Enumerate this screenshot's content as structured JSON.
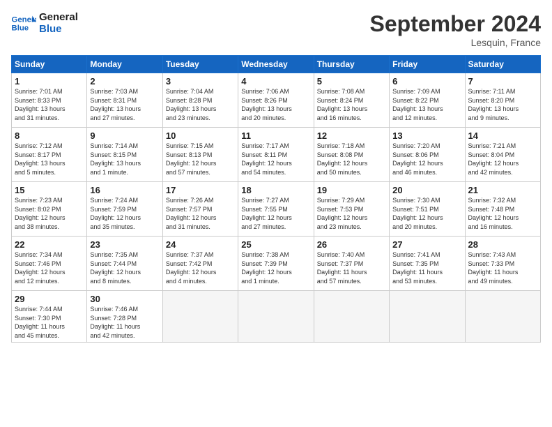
{
  "logo": {
    "line1": "General",
    "line2": "Blue"
  },
  "title": "September 2024",
  "location": "Lesquin, France",
  "days_header": [
    "Sunday",
    "Monday",
    "Tuesday",
    "Wednesday",
    "Thursday",
    "Friday",
    "Saturday"
  ],
  "weeks": [
    [
      {
        "day": "1",
        "info": "Sunrise: 7:01 AM\nSunset: 8:33 PM\nDaylight: 13 hours\nand 31 minutes."
      },
      {
        "day": "2",
        "info": "Sunrise: 7:03 AM\nSunset: 8:31 PM\nDaylight: 13 hours\nand 27 minutes."
      },
      {
        "day": "3",
        "info": "Sunrise: 7:04 AM\nSunset: 8:28 PM\nDaylight: 13 hours\nand 23 minutes."
      },
      {
        "day": "4",
        "info": "Sunrise: 7:06 AM\nSunset: 8:26 PM\nDaylight: 13 hours\nand 20 minutes."
      },
      {
        "day": "5",
        "info": "Sunrise: 7:08 AM\nSunset: 8:24 PM\nDaylight: 13 hours\nand 16 minutes."
      },
      {
        "day": "6",
        "info": "Sunrise: 7:09 AM\nSunset: 8:22 PM\nDaylight: 13 hours\nand 12 minutes."
      },
      {
        "day": "7",
        "info": "Sunrise: 7:11 AM\nSunset: 8:20 PM\nDaylight: 13 hours\nand 9 minutes."
      }
    ],
    [
      {
        "day": "8",
        "info": "Sunrise: 7:12 AM\nSunset: 8:17 PM\nDaylight: 13 hours\nand 5 minutes."
      },
      {
        "day": "9",
        "info": "Sunrise: 7:14 AM\nSunset: 8:15 PM\nDaylight: 13 hours\nand 1 minute."
      },
      {
        "day": "10",
        "info": "Sunrise: 7:15 AM\nSunset: 8:13 PM\nDaylight: 12 hours\nand 57 minutes."
      },
      {
        "day": "11",
        "info": "Sunrise: 7:17 AM\nSunset: 8:11 PM\nDaylight: 12 hours\nand 54 minutes."
      },
      {
        "day": "12",
        "info": "Sunrise: 7:18 AM\nSunset: 8:08 PM\nDaylight: 12 hours\nand 50 minutes."
      },
      {
        "day": "13",
        "info": "Sunrise: 7:20 AM\nSunset: 8:06 PM\nDaylight: 12 hours\nand 46 minutes."
      },
      {
        "day": "14",
        "info": "Sunrise: 7:21 AM\nSunset: 8:04 PM\nDaylight: 12 hours\nand 42 minutes."
      }
    ],
    [
      {
        "day": "15",
        "info": "Sunrise: 7:23 AM\nSunset: 8:02 PM\nDaylight: 12 hours\nand 38 minutes."
      },
      {
        "day": "16",
        "info": "Sunrise: 7:24 AM\nSunset: 7:59 PM\nDaylight: 12 hours\nand 35 minutes."
      },
      {
        "day": "17",
        "info": "Sunrise: 7:26 AM\nSunset: 7:57 PM\nDaylight: 12 hours\nand 31 minutes."
      },
      {
        "day": "18",
        "info": "Sunrise: 7:27 AM\nSunset: 7:55 PM\nDaylight: 12 hours\nand 27 minutes."
      },
      {
        "day": "19",
        "info": "Sunrise: 7:29 AM\nSunset: 7:53 PM\nDaylight: 12 hours\nand 23 minutes."
      },
      {
        "day": "20",
        "info": "Sunrise: 7:30 AM\nSunset: 7:51 PM\nDaylight: 12 hours\nand 20 minutes."
      },
      {
        "day": "21",
        "info": "Sunrise: 7:32 AM\nSunset: 7:48 PM\nDaylight: 12 hours\nand 16 minutes."
      }
    ],
    [
      {
        "day": "22",
        "info": "Sunrise: 7:34 AM\nSunset: 7:46 PM\nDaylight: 12 hours\nand 12 minutes."
      },
      {
        "day": "23",
        "info": "Sunrise: 7:35 AM\nSunset: 7:44 PM\nDaylight: 12 hours\nand 8 minutes."
      },
      {
        "day": "24",
        "info": "Sunrise: 7:37 AM\nSunset: 7:42 PM\nDaylight: 12 hours\nand 4 minutes."
      },
      {
        "day": "25",
        "info": "Sunrise: 7:38 AM\nSunset: 7:39 PM\nDaylight: 12 hours\nand 1 minute."
      },
      {
        "day": "26",
        "info": "Sunrise: 7:40 AM\nSunset: 7:37 PM\nDaylight: 11 hours\nand 57 minutes."
      },
      {
        "day": "27",
        "info": "Sunrise: 7:41 AM\nSunset: 7:35 PM\nDaylight: 11 hours\nand 53 minutes."
      },
      {
        "day": "28",
        "info": "Sunrise: 7:43 AM\nSunset: 7:33 PM\nDaylight: 11 hours\nand 49 minutes."
      }
    ],
    [
      {
        "day": "29",
        "info": "Sunrise: 7:44 AM\nSunset: 7:30 PM\nDaylight: 11 hours\nand 45 minutes."
      },
      {
        "day": "30",
        "info": "Sunrise: 7:46 AM\nSunset: 7:28 PM\nDaylight: 11 hours\nand 42 minutes."
      },
      {
        "day": "",
        "info": ""
      },
      {
        "day": "",
        "info": ""
      },
      {
        "day": "",
        "info": ""
      },
      {
        "day": "",
        "info": ""
      },
      {
        "day": "",
        "info": ""
      }
    ]
  ]
}
